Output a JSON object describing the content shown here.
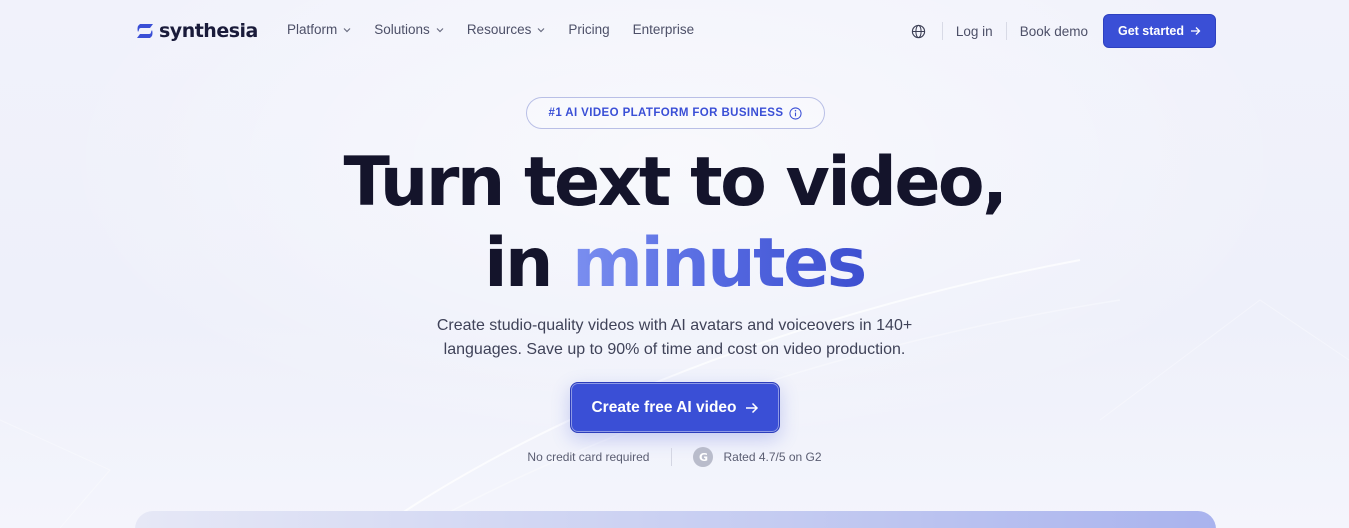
{
  "brand": {
    "name": "synthesia",
    "accent": "#3a4fd6",
    "text_dark": "#14142b"
  },
  "nav": {
    "items": [
      {
        "label": "Platform",
        "has_dropdown": true
      },
      {
        "label": "Solutions",
        "has_dropdown": true
      },
      {
        "label": "Resources",
        "has_dropdown": true
      },
      {
        "label": "Pricing",
        "has_dropdown": false
      },
      {
        "label": "Enterprise",
        "has_dropdown": false
      }
    ],
    "language_icon": "globe-icon",
    "login_label": "Log in",
    "demo_label": "Book demo",
    "cta_label": "Get started",
    "cta_icon": "arrow-right-icon"
  },
  "hero": {
    "badge": "#1 AI VIDEO PLATFORM FOR BUSINESS",
    "badge_icon": "info-icon",
    "title_line1": "Turn text to video,",
    "title_line2_prefix": "in ",
    "title_line2_highlight": "minutes",
    "subtitle_line1": "Create studio-quality videos with AI avatars and voiceovers in 140+",
    "subtitle_line2": "languages. Save up to 90% of time and cost on video production.",
    "cta_label": "Create free AI video",
    "cta_icon": "arrow-right-icon",
    "note_left": "No credit card required",
    "rating_logo": "G",
    "rating_text": "Rated 4.7/5 on G2"
  }
}
